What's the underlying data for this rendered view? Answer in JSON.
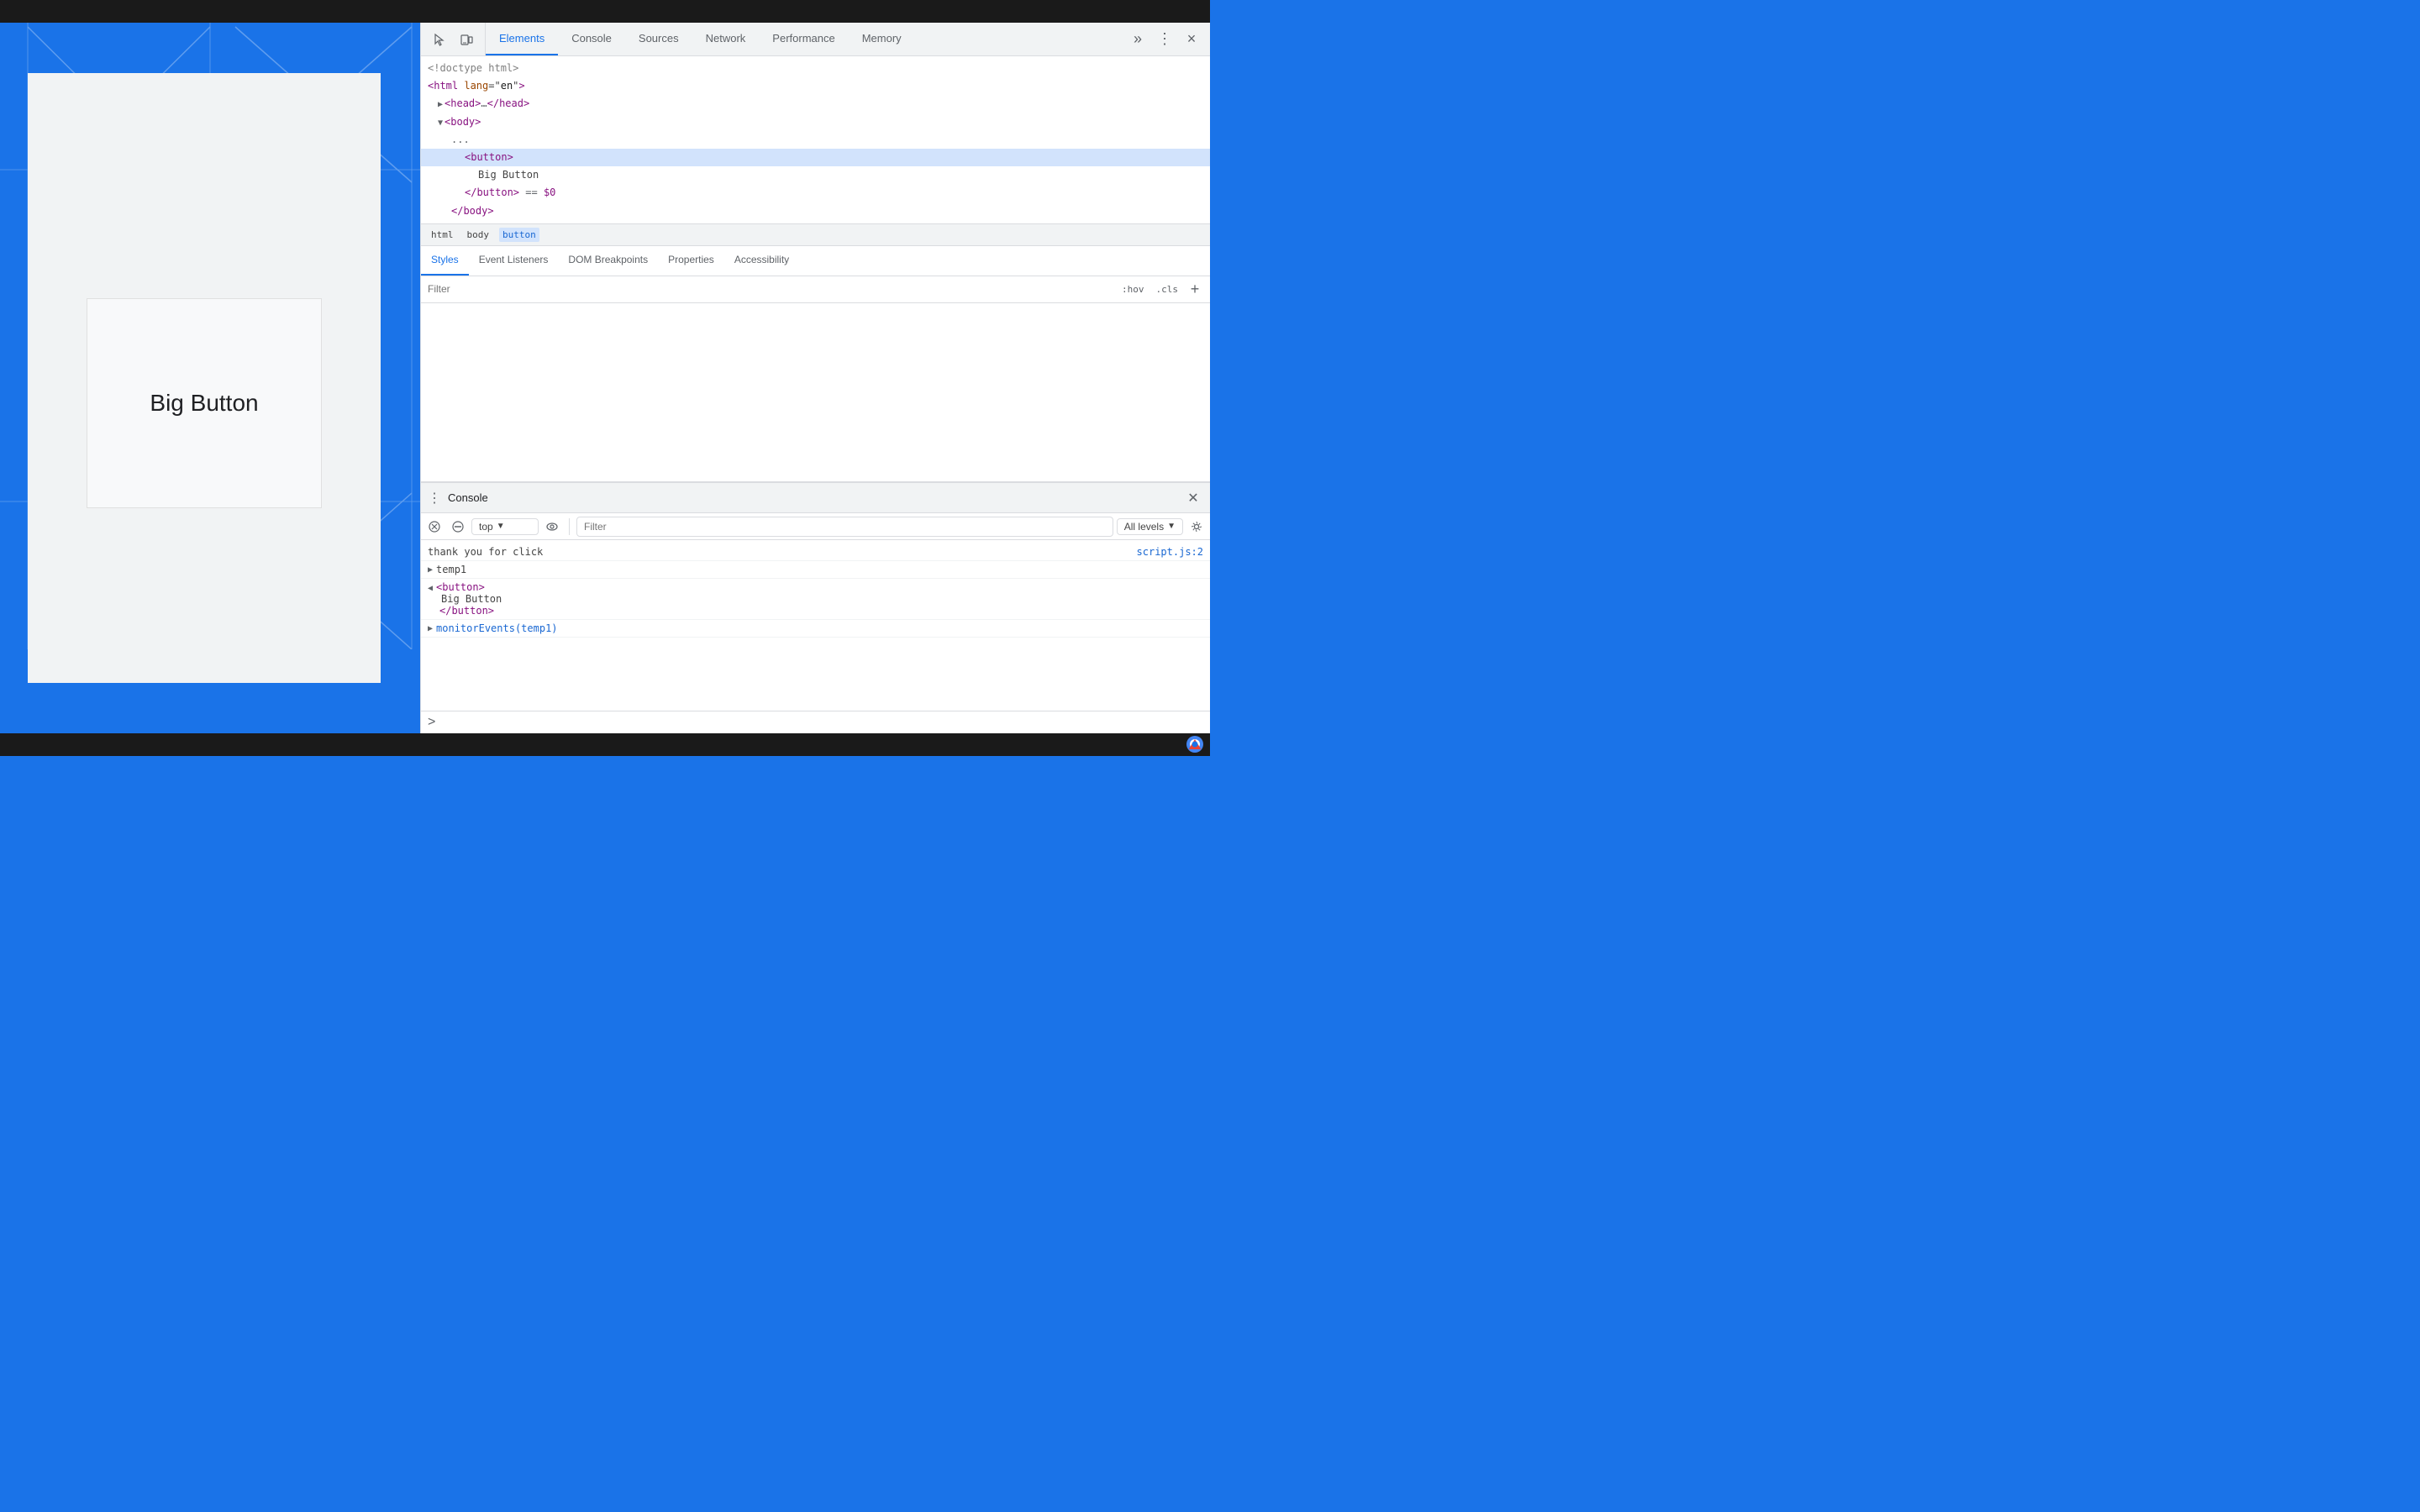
{
  "topBar": {},
  "bottomBar": {},
  "page": {
    "buttonText": "Big Button",
    "bgColor": "#1a73e8"
  },
  "devtools": {
    "tabs": [
      {
        "id": "elements",
        "label": "Elements",
        "active": true
      },
      {
        "id": "console",
        "label": "Console",
        "active": false
      },
      {
        "id": "sources",
        "label": "Sources",
        "active": false
      },
      {
        "id": "network",
        "label": "Network",
        "active": false
      },
      {
        "id": "performance",
        "label": "Performance",
        "active": false
      },
      {
        "id": "memory",
        "label": "Memory",
        "active": false
      }
    ],
    "moreTabsLabel": "»",
    "settingsLabel": "⋮",
    "closeLabel": "×",
    "htmlTree": {
      "lines": [
        {
          "id": "doctype",
          "indent": 0,
          "content": "<!doctype html>"
        },
        {
          "id": "html-open",
          "indent": 0,
          "content": "<html lang=\"en\">"
        },
        {
          "id": "head",
          "indent": 1,
          "content": "▶<head>…</head>"
        },
        {
          "id": "body-open",
          "indent": 1,
          "content": "▼<body>"
        },
        {
          "id": "ellipsis",
          "indent": 2,
          "content": "..."
        },
        {
          "id": "button-open",
          "indent": 3,
          "content": "<button>"
        },
        {
          "id": "button-text",
          "indent": 4,
          "content": "Big Button"
        },
        {
          "id": "button-close",
          "indent": 3,
          "content": "</button> == $0"
        },
        {
          "id": "body-close",
          "indent": 2,
          "content": "</body>"
        }
      ]
    },
    "breadcrumbs": [
      {
        "id": "html",
        "label": "html",
        "active": false
      },
      {
        "id": "body",
        "label": "body",
        "active": false
      },
      {
        "id": "button",
        "label": "button",
        "active": true
      }
    ],
    "stylesTabs": [
      {
        "id": "styles",
        "label": "Styles",
        "active": true
      },
      {
        "id": "event-listeners",
        "label": "Event Listeners",
        "active": false
      },
      {
        "id": "dom-breakpoints",
        "label": "DOM Breakpoints",
        "active": false
      },
      {
        "id": "properties",
        "label": "Properties",
        "active": false
      },
      {
        "id": "accessibility",
        "label": "Accessibility",
        "active": false
      }
    ],
    "filterBar": {
      "placeholder": "Filter",
      "hov": ":hov",
      "cls": ".cls",
      "add": "+"
    },
    "console": {
      "title": "Console",
      "toolbar": {
        "context": "top",
        "filterPlaceholder": "Filter",
        "levels": "All levels"
      },
      "lines": [
        {
          "id": "log1",
          "type": "log",
          "text": "thank you for click",
          "source": "script.js:2",
          "expandable": false
        },
        {
          "id": "temp1",
          "type": "expand",
          "label": "temp1",
          "expandable": true,
          "expanded": false
        },
        {
          "id": "button-ref",
          "type": "expand",
          "expandable": true,
          "expanded": true,
          "lines": [
            "<button>",
            "    Big Button",
            "</button>"
          ]
        },
        {
          "id": "monitor",
          "type": "command",
          "text": "monitorEvents(temp1)",
          "expandable": true
        }
      ]
    }
  }
}
